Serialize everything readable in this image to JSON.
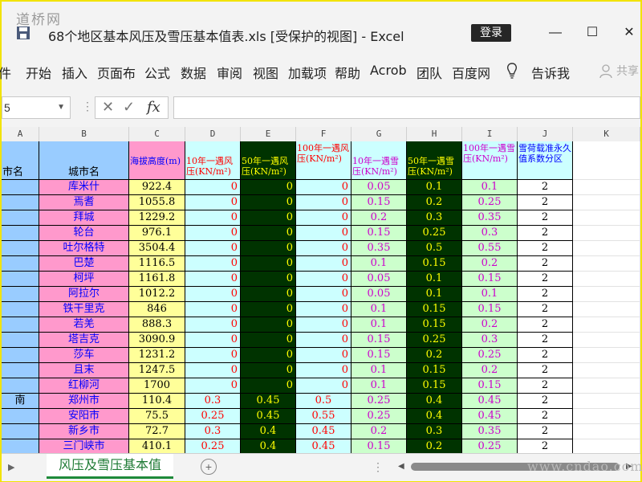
{
  "watermark_top": "道桥网",
  "watermark_bottom": "www.cndao.com",
  "window": {
    "title": "68个地区基本风压及雪压基本值表.xls  [受保护的视图]  -  Excel",
    "login": "登录",
    "minimize": "—",
    "maximize": "☐",
    "close": "✕"
  },
  "ribbon": {
    "tabs": [
      "件",
      "开始",
      "插入",
      "页面布",
      "公式",
      "数据",
      "审阅",
      "视图",
      "加载项",
      "帮助",
      "Acrob",
      "团队",
      "百度网"
    ],
    "tell_me": "告诉我",
    "share": "共享"
  },
  "formula_bar": {
    "name_box": "5",
    "cancel": "✕",
    "enter": "✓",
    "fx": "fx",
    "value": ""
  },
  "columns": [
    "A",
    "B",
    "C",
    "D",
    "E",
    "F",
    "G",
    "H",
    "I",
    "J",
    "K"
  ],
  "header": {
    "a": "市名",
    "b": "城市名",
    "c": "海拔高度(m)",
    "d": "10年一遇风压(KN/m²)",
    "e": "50年一遇风压(KN/m²)",
    "f": "100年一遇风压(KN/m²)",
    "g": "10年一遇雪压(KN/m²)",
    "h": "50年一遇雪压(KN/m²)",
    "i": "100年一遇雪压(KN/m²)",
    "j": "雪荷载准永久值系数分区"
  },
  "rows": [
    {
      "a": "",
      "b": "库米什",
      "c": "922.4",
      "d": "0",
      "e": "0",
      "f": "0",
      "g": "0.05",
      "h": "0.1",
      "i": "0.1",
      "j": "2"
    },
    {
      "a": "",
      "b": "焉耆",
      "c": "1055.8",
      "d": "0",
      "e": "0",
      "f": "0",
      "g": "0.15",
      "h": "0.2",
      "i": "0.25",
      "j": "2"
    },
    {
      "a": "",
      "b": "拜城",
      "c": "1229.2",
      "d": "0",
      "e": "0",
      "f": "0",
      "g": "0.2",
      "h": "0.3",
      "i": "0.35",
      "j": "2"
    },
    {
      "a": "",
      "b": "轮台",
      "c": "976.1",
      "d": "0",
      "e": "0",
      "f": "0",
      "g": "0.15",
      "h": "0.25",
      "i": "0.3",
      "j": "2"
    },
    {
      "a": "",
      "b": "吐尔格特",
      "c": "3504.4",
      "d": "0",
      "e": "0",
      "f": "0",
      "g": "0.35",
      "h": "0.5",
      "i": "0.55",
      "j": "2"
    },
    {
      "a": "",
      "b": "巴楚",
      "c": "1116.5",
      "d": "0",
      "e": "0",
      "f": "0",
      "g": "0.1",
      "h": "0.15",
      "i": "0.2",
      "j": "2"
    },
    {
      "a": "",
      "b": "柯坪",
      "c": "1161.8",
      "d": "0",
      "e": "0",
      "f": "0",
      "g": "0.05",
      "h": "0.1",
      "i": "0.15",
      "j": "2"
    },
    {
      "a": "",
      "b": "阿拉尔",
      "c": "1012.2",
      "d": "0",
      "e": "0",
      "f": "0",
      "g": "0.05",
      "h": "0.1",
      "i": "0.1",
      "j": "2"
    },
    {
      "a": "",
      "b": "铁干里克",
      "c": "846",
      "d": "0",
      "e": "0",
      "f": "0",
      "g": "0.1",
      "h": "0.15",
      "i": "0.15",
      "j": "2"
    },
    {
      "a": "",
      "b": "若羌",
      "c": "888.3",
      "d": "0",
      "e": "0",
      "f": "0",
      "g": "0.1",
      "h": "0.15",
      "i": "0.2",
      "j": "2"
    },
    {
      "a": "",
      "b": "塔吉克",
      "c": "3090.9",
      "d": "0",
      "e": "0",
      "f": "0",
      "g": "0.15",
      "h": "0.25",
      "i": "0.3",
      "j": "2"
    },
    {
      "a": "",
      "b": "莎车",
      "c": "1231.2",
      "d": "0",
      "e": "0",
      "f": "0",
      "g": "0.15",
      "h": "0.2",
      "i": "0.25",
      "j": "2"
    },
    {
      "a": "",
      "b": "且末",
      "c": "1247.5",
      "d": "0",
      "e": "0",
      "f": "0",
      "g": "0.1",
      "h": "0.15",
      "i": "0.2",
      "j": "2"
    },
    {
      "a": "",
      "b": "红柳河",
      "c": "1700",
      "d": "0",
      "e": "0",
      "f": "0",
      "g": "0.1",
      "h": "0.15",
      "i": "0.15",
      "j": "2"
    },
    {
      "a": "南",
      "b": "郑州市",
      "c": "110.4",
      "d": "0.3",
      "e": "0.45",
      "f": "0.5",
      "g": "0.25",
      "h": "0.4",
      "i": "0.45",
      "j": "2"
    },
    {
      "a": "",
      "b": "安阳市",
      "c": "75.5",
      "d": "0.25",
      "e": "0.45",
      "f": "0.55",
      "g": "0.25",
      "h": "0.4",
      "i": "0.45",
      "j": "2"
    },
    {
      "a": "",
      "b": "新乡市",
      "c": "72.7",
      "d": "0.3",
      "e": "0.4",
      "f": "0.45",
      "g": "0.2",
      "h": "0.3",
      "i": "0.35",
      "j": "2"
    },
    {
      "a": "",
      "b": "三门峡市",
      "c": "410.1",
      "d": "0.25",
      "e": "0.4",
      "f": "0.45",
      "g": "0.15",
      "h": "0.2",
      "i": "0.25",
      "j": "2"
    }
  ],
  "sheet": {
    "active_tab": "风压及雪压基本值",
    "add": "+",
    "more": "⋮",
    "prev": "◀",
    "next": "▶",
    "scroll_left": "◀",
    "scroll_right": "▶"
  },
  "colors": {
    "city_bg": "#ff99cc",
    "province_bg": "#99ccff",
    "altitude_bg": "#ffff99",
    "light_cyan_bg": "#ccffff",
    "dark_green_bg": "#003300",
    "light_green_bg": "#ccffcc",
    "red_text": "#ff0000",
    "yellow_text": "#ffff00",
    "magenta_text": "#cc00cc",
    "blue_text": "#0000ff"
  }
}
